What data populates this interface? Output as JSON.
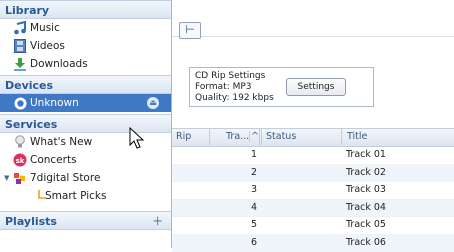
{
  "sidebar": {
    "library_title": "Library",
    "library_items": [
      {
        "label": "Music",
        "icon": "music-note-icon"
      },
      {
        "label": "Videos",
        "icon": "film-icon"
      },
      {
        "label": "Downloads",
        "icon": "download-arrow-icon"
      }
    ],
    "devices_title": "Devices",
    "device": {
      "label": "Unknown",
      "icon": "device-icon",
      "eject_icon": "eject-icon"
    },
    "services_title": "Services",
    "service_items": [
      {
        "label": "What's New",
        "icon": "lightbulb-icon"
      },
      {
        "label": "Concerts",
        "icon": "songkick-icon"
      },
      {
        "label": "7digital Store",
        "icon": "7digital-icon"
      }
    ],
    "sub_item": {
      "label": "Smart Picks",
      "icon": "sub-arrow-icon"
    },
    "playlists_title": "Playlists",
    "playlists_add": "+"
  },
  "toolbar": {
    "icon": "tree-view-icon"
  },
  "rip_settings": {
    "title": "CD Rip Settings",
    "format": "Format: MP3",
    "quality": "Quality: 192 kbps",
    "button": "Settings"
  },
  "table": {
    "columns": {
      "rip": "Rip",
      "track": "Tra...",
      "sort": "^",
      "status": "Status",
      "title": "Title"
    },
    "rows": [
      {
        "track": "1",
        "title": "Track 01"
      },
      {
        "track": "2",
        "title": "Track 02"
      },
      {
        "track": "3",
        "title": "Track 03"
      },
      {
        "track": "4",
        "title": "Track 04"
      },
      {
        "track": "5",
        "title": "Track 05"
      },
      {
        "track": "6",
        "title": "Track 06"
      }
    ]
  },
  "colors": {
    "accent": "#3f79c4",
    "section_text": "#2a5a96"
  }
}
